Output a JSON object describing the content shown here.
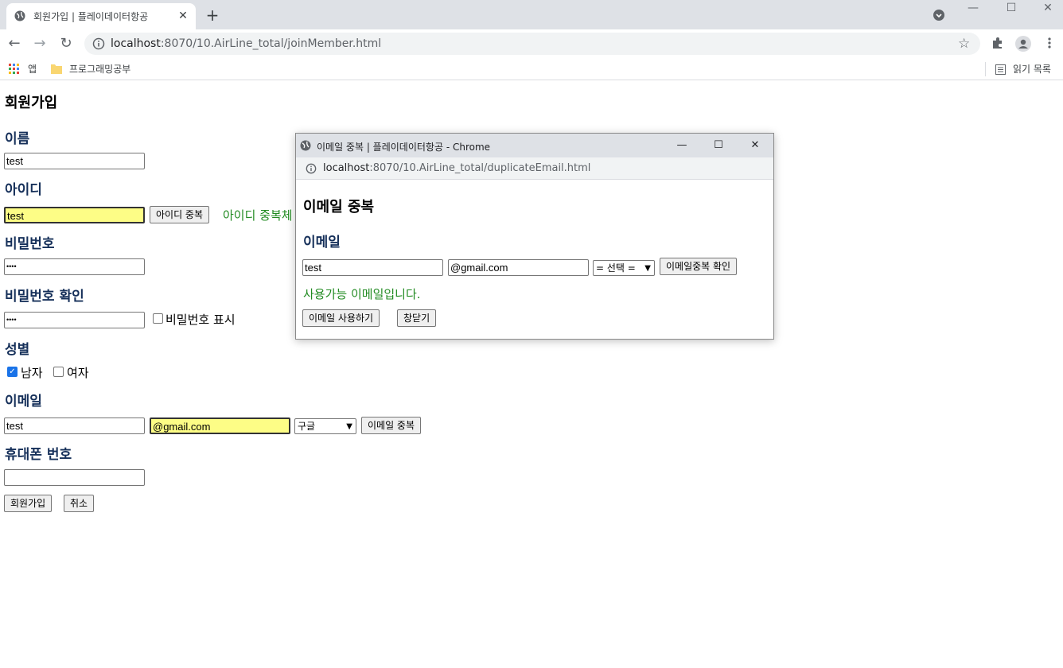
{
  "browser": {
    "tab_title": "회원가입 | 플레이데이터항공",
    "tab_close": "✕",
    "new_tab": "+",
    "window_controls": {
      "minimize": "—",
      "maximize": "☐",
      "close": "✕"
    },
    "nav": {
      "back": "←",
      "forward": "→",
      "reload": "↻"
    },
    "url_host": "localhost",
    "url_path": ":8070/10.AirLine_total/joinMember.html",
    "star": "☆",
    "bookmarks": {
      "apps_label": "앱",
      "folder_label": "프로그래밍공부",
      "reading_list": "읽기 목록"
    }
  },
  "page": {
    "title": "회원가입",
    "name": {
      "label": "이름",
      "value": "test"
    },
    "id": {
      "label": "아이디",
      "value": "test",
      "check_button": "아이디 중복",
      "status": "아이디 중복체"
    },
    "password": {
      "label": "비밀번호",
      "value": "••••"
    },
    "password_confirm": {
      "label": "비밀번호 확인",
      "value": "••••",
      "show_label": "비밀번호 표시"
    },
    "gender": {
      "label": "성별",
      "male": "남자",
      "female": "여자",
      "male_checked": true,
      "female_checked": false
    },
    "email": {
      "label": "이메일",
      "local": "test",
      "domain": "@gmail.com",
      "provider": "구글",
      "check_button": "이메일 중복"
    },
    "phone": {
      "label": "휴대폰 번호",
      "value": ""
    },
    "buttons": {
      "join": "회원가입",
      "cancel": "취소"
    }
  },
  "popup": {
    "window_title": "이메일 중복 | 플레이데이터항공 - Chrome",
    "window_controls": {
      "minimize": "—",
      "maximize": "☐",
      "close": "✕"
    },
    "url_host": "localhost",
    "url_path": ":8070/10.AirLine_total/duplicateEmail.html",
    "heading": "이메일 중복",
    "email_label": "이메일",
    "local": "test",
    "domain": "@gmail.com",
    "select": "= 선택 =",
    "check_button": "이메일중복 확인",
    "status": "사용가능 이메일입니다.",
    "use_button": "이메일 사용하기",
    "close_button": "창닫기"
  },
  "colors": {
    "heading": "#16305a",
    "success": "#228b22",
    "highlight": "#fdfd86",
    "chrome_frame": "#dee1e6"
  }
}
